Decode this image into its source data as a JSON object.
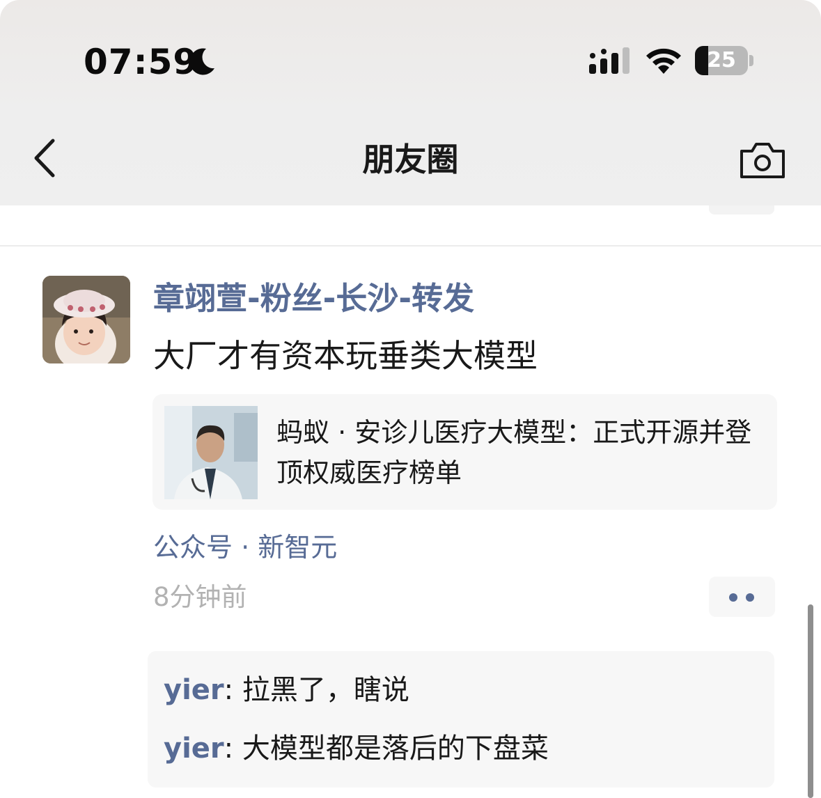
{
  "status_bar": {
    "time": "07:59",
    "battery_level": "25",
    "battery_fraction": 0.25,
    "icons": [
      "moon-icon",
      "signal-icon",
      "wifi-icon",
      "battery-icon"
    ]
  },
  "nav": {
    "title": "朋友圈",
    "back_icon": "chevron-left-icon",
    "camera_icon": "camera-icon"
  },
  "post": {
    "author": "章翊萱-粉丝-长沙-转发",
    "text": "大厂才有资本玩垂类大模型",
    "link": {
      "title": "蚂蚁 · 安诊儿医疗大模型：正式开源并登顶权威医疗榜单"
    },
    "source": "公众号 · 新智元",
    "time_ago": "8分钟前",
    "comments": [
      {
        "name": "yier",
        "sep": ": ",
        "text": "拉黑了，瞎说"
      },
      {
        "name": "yier",
        "sep": ": ",
        "text": "大模型都是落后的下盘菜"
      }
    ]
  },
  "colors": {
    "link_blue": "#576b95",
    "text": "#191919",
    "muted": "#b2b2b2",
    "card_bg": "#f7f7f7"
  }
}
